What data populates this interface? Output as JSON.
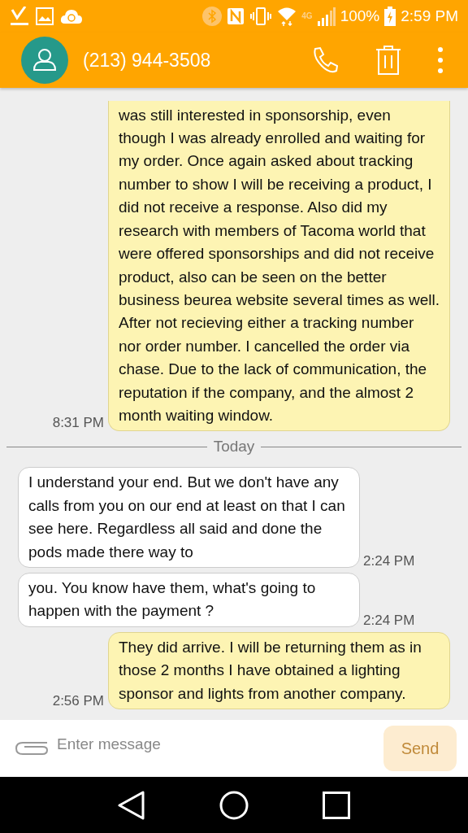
{
  "status_bar": {
    "network_type": "4G",
    "battery": "100%",
    "time": "2:59 PM"
  },
  "header": {
    "title": "(213) 944-3508"
  },
  "messages": [
    {
      "kind": "sent",
      "text": "was still interested in sponsorship, even though I was already enrolled and waiting for my order. Once again asked about tracking number to show I will be receiving a product, I did not receive a response. Also did my research with members of Tacoma world that were offered sponsorships and did not receive product, also can be seen on the better business beurea website several times as well. After not recieving either a tracking number nor order number. I cancelled the order via chase. Due to the lack of communication, the reputation if the company, and the almost 2 month waiting window.",
      "time": "8:31 PM"
    },
    {
      "kind": "divider",
      "text": "Today"
    },
    {
      "kind": "received",
      "text": "I understand your end. But we don't have any calls from you on our end at least on that I can see here. Regardless all said and done the pods made there way to",
      "time": "2:24 PM"
    },
    {
      "kind": "received",
      "text": "you. You know have them, what's going to happen with the payment ?",
      "time": "2:24 PM"
    },
    {
      "kind": "sent",
      "text": "They did arrive. I will be returning them as in those 2 months I have obtained a lighting sponsor and lights from another company.",
      "time": "2:56 PM"
    }
  ],
  "composer": {
    "placeholder": "Enter message",
    "send_button": {
      "label": "Send",
      "disabled": true
    }
  }
}
